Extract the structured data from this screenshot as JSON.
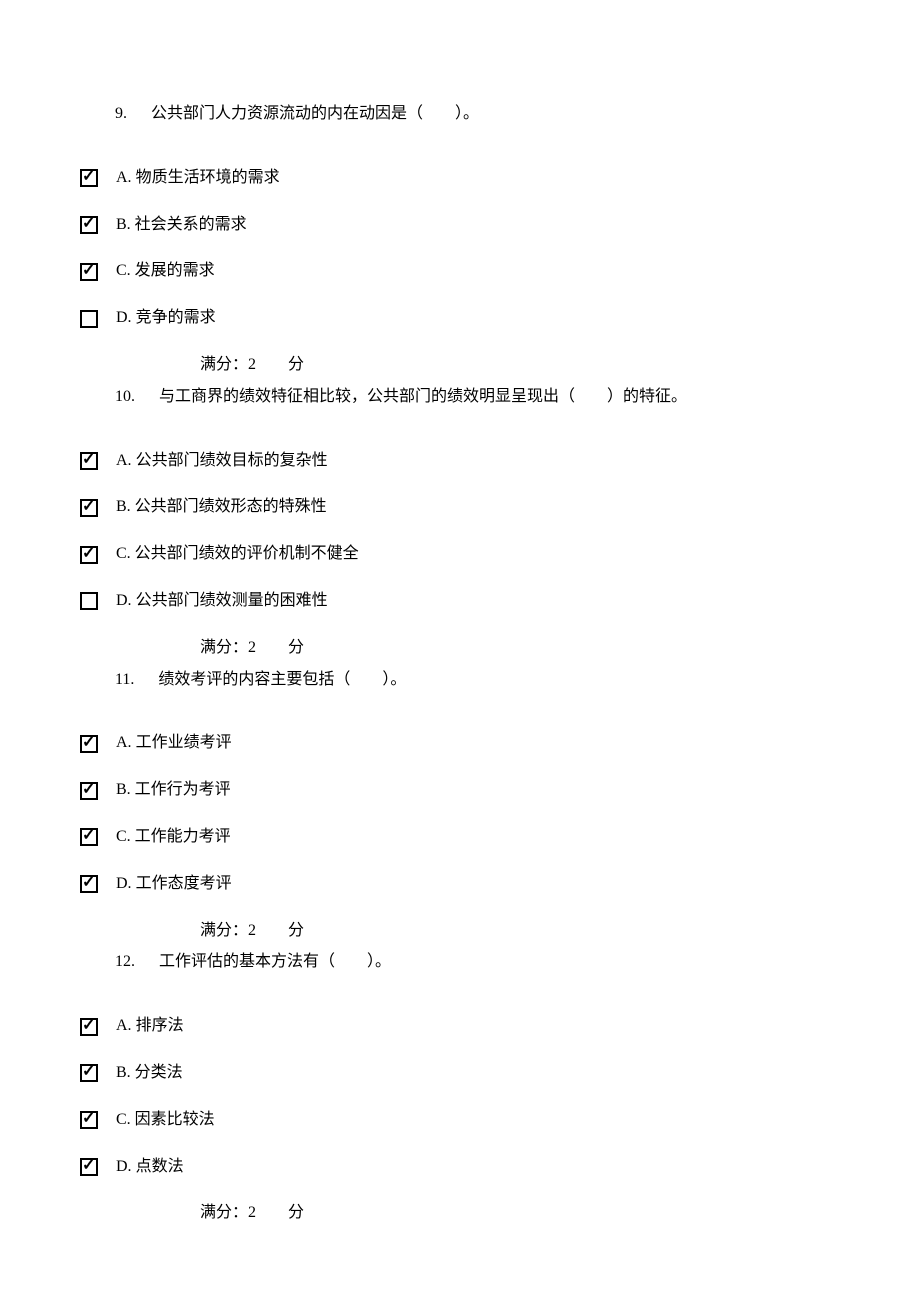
{
  "questions": [
    {
      "number": "9.",
      "text": "公共部门人力资源流动的内在动因是（　　）。",
      "options": [
        {
          "letter": "A.",
          "text": "物质生活环境的需求",
          "checked": true
        },
        {
          "letter": "B.",
          "text": "社会关系的需求",
          "checked": true
        },
        {
          "letter": "C.",
          "text": "发展的需求",
          "checked": true
        },
        {
          "letter": "D.",
          "text": "竞争的需求",
          "checked": false
        }
      ],
      "score": "满分：2　　分"
    },
    {
      "number": "10.",
      "text": "与工商界的绩效特征相比较，公共部门的绩效明显呈现出（　　）的特征。",
      "options": [
        {
          "letter": "A.",
          "text": "公共部门绩效目标的复杂性",
          "checked": true
        },
        {
          "letter": "B.",
          "text": "公共部门绩效形态的特殊性",
          "checked": true
        },
        {
          "letter": "C.",
          "text": "公共部门绩效的评价机制不健全",
          "checked": true
        },
        {
          "letter": "D.",
          "text": "公共部门绩效测量的困难性",
          "checked": false
        }
      ],
      "score": "满分：2　　分"
    },
    {
      "number": "11.",
      "text": "绩效考评的内容主要包括（　　）。",
      "options": [
        {
          "letter": "A.",
          "text": "工作业绩考评",
          "checked": true
        },
        {
          "letter": "B.",
          "text": "工作行为考评",
          "checked": true
        },
        {
          "letter": "C.",
          "text": "工作能力考评",
          "checked": true
        },
        {
          "letter": "D.",
          "text": "工作态度考评",
          "checked": true
        }
      ],
      "score": "满分：2　　分"
    },
    {
      "number": "12.",
      "text": "工作评估的基本方法有（　　）。",
      "options": [
        {
          "letter": "A.",
          "text": "排序法",
          "checked": true
        },
        {
          "letter": "B.",
          "text": "分类法",
          "checked": true
        },
        {
          "letter": "C.",
          "text": "因素比较法",
          "checked": true
        },
        {
          "letter": "D.",
          "text": "点数法",
          "checked": true
        }
      ],
      "score": "满分：2　　分"
    }
  ]
}
